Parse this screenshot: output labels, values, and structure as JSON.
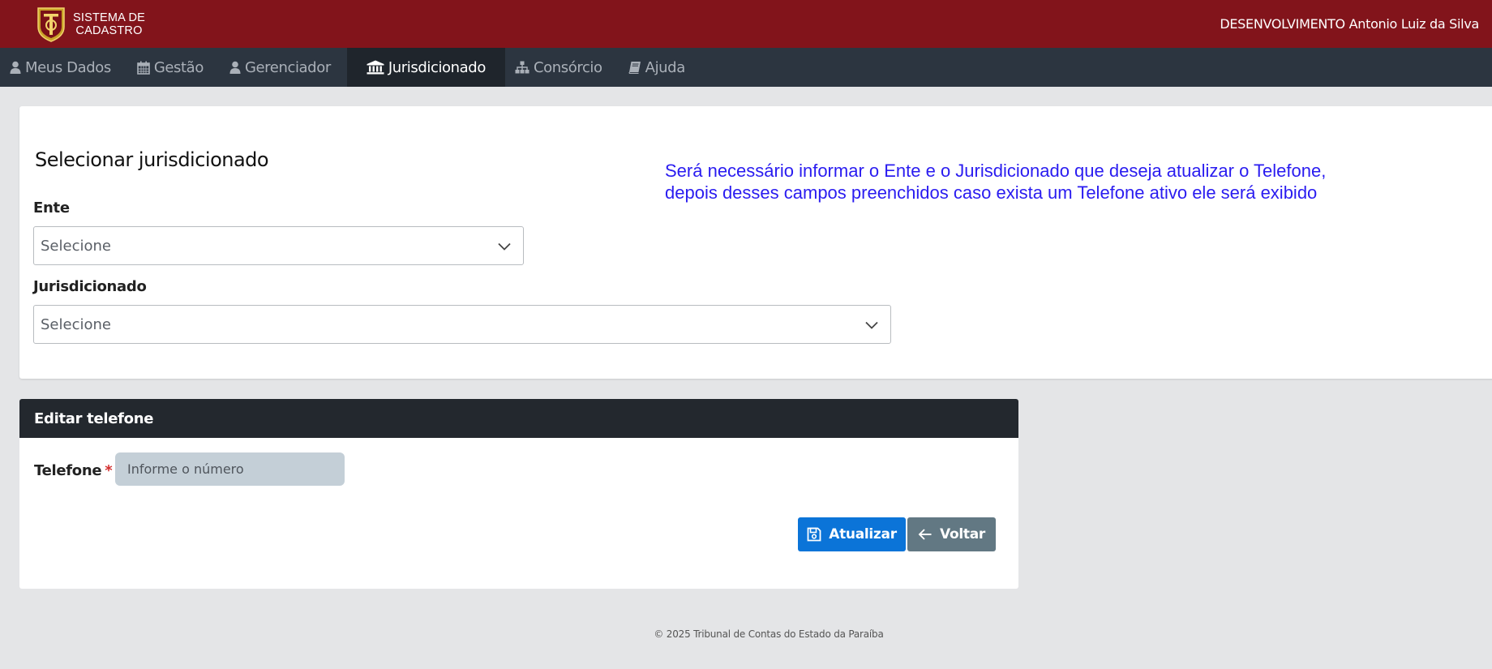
{
  "header": {
    "brand_line1": "SISTEMA DE",
    "brand_line2": "CADASTRO",
    "user": "DESENVOLVIMENTO Antonio Luiz da Silva",
    "bg_color": "#82141b"
  },
  "nav": {
    "items": [
      {
        "label": "Meus Dados",
        "icon": "user-icon"
      },
      {
        "label": "Gestão",
        "icon": "calendar-icon"
      },
      {
        "label": "Gerenciador",
        "icon": "user-icon"
      },
      {
        "label": "Jurisdicionado",
        "icon": "institution-icon",
        "active": true
      },
      {
        "label": "Consórcio",
        "icon": "sitemap-icon"
      },
      {
        "label": "Ajuda",
        "icon": "book-icon"
      }
    ]
  },
  "select_section": {
    "title": "Selecionar jurisdicionado",
    "ente_label": "Ente",
    "ente_value": "Selecione",
    "jurisdicionado_label": "Jurisdicionado",
    "jurisdicionado_value": "Selecione",
    "annotation_line1": "Será necessário informar o Ente e o Jurisdicionado que deseja atualizar o Telefone,",
    "annotation_line2": "depois desses campos preenchidos caso exista um Telefone ativo ele será exibido"
  },
  "edit_section": {
    "title": "Editar telefone",
    "phone_label": "Telefone",
    "required_mark": "*",
    "phone_placeholder": "Informe o número",
    "phone_value": "",
    "update_label": "Atualizar",
    "back_label": "Voltar"
  },
  "footer": {
    "text": "© 2025 Tribunal de Contas do Estado da Paraíba"
  }
}
